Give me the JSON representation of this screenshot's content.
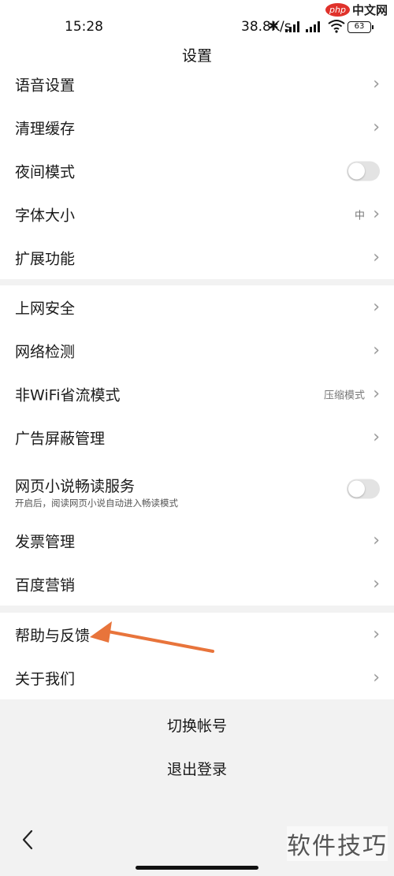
{
  "status_bar": {
    "time": "15:28",
    "network_speed": "38.8K/s",
    "battery": "63",
    "icons": [
      "bluetooth-icon",
      "signal-icon",
      "signal-hd-icon",
      "wifi-icon",
      "battery-icon"
    ]
  },
  "watermark": {
    "logo_badge": "php",
    "logo_text": "中文网",
    "bottom_text": "软件技巧"
  },
  "header": {
    "title": "设置"
  },
  "section1": {
    "items": [
      {
        "label": "语音设置",
        "control": "chevron"
      },
      {
        "label": "清理缓存",
        "control": "chevron"
      },
      {
        "label": "夜间模式",
        "control": "toggle",
        "on": false
      },
      {
        "label": "字体大小",
        "value": "中",
        "control": "chevron"
      },
      {
        "label": "扩展功能",
        "control": "chevron"
      }
    ]
  },
  "section2": {
    "items": [
      {
        "label": "上网安全",
        "control": "chevron"
      },
      {
        "label": "网络检测",
        "control": "chevron"
      },
      {
        "label": "非WiFi省流模式",
        "value": "压缩模式",
        "control": "chevron"
      },
      {
        "label": "广告屏蔽管理",
        "control": "chevron"
      },
      {
        "label": "网页小说畅读服务",
        "sub": "开启后，阅读网页小说自动进入畅读模式",
        "control": "toggle",
        "on": false
      },
      {
        "label": "发票管理",
        "control": "chevron"
      },
      {
        "label": "百度营销",
        "control": "chevron"
      }
    ]
  },
  "section3": {
    "items": [
      {
        "label": "帮助与反馈",
        "control": "chevron"
      },
      {
        "label": "关于我们",
        "control": "chevron"
      }
    ]
  },
  "account": {
    "switch_label": "切换帐号",
    "logout_label": "退出登录"
  },
  "annotation_color": "#e8743b",
  "chevron_glyph": "›"
}
